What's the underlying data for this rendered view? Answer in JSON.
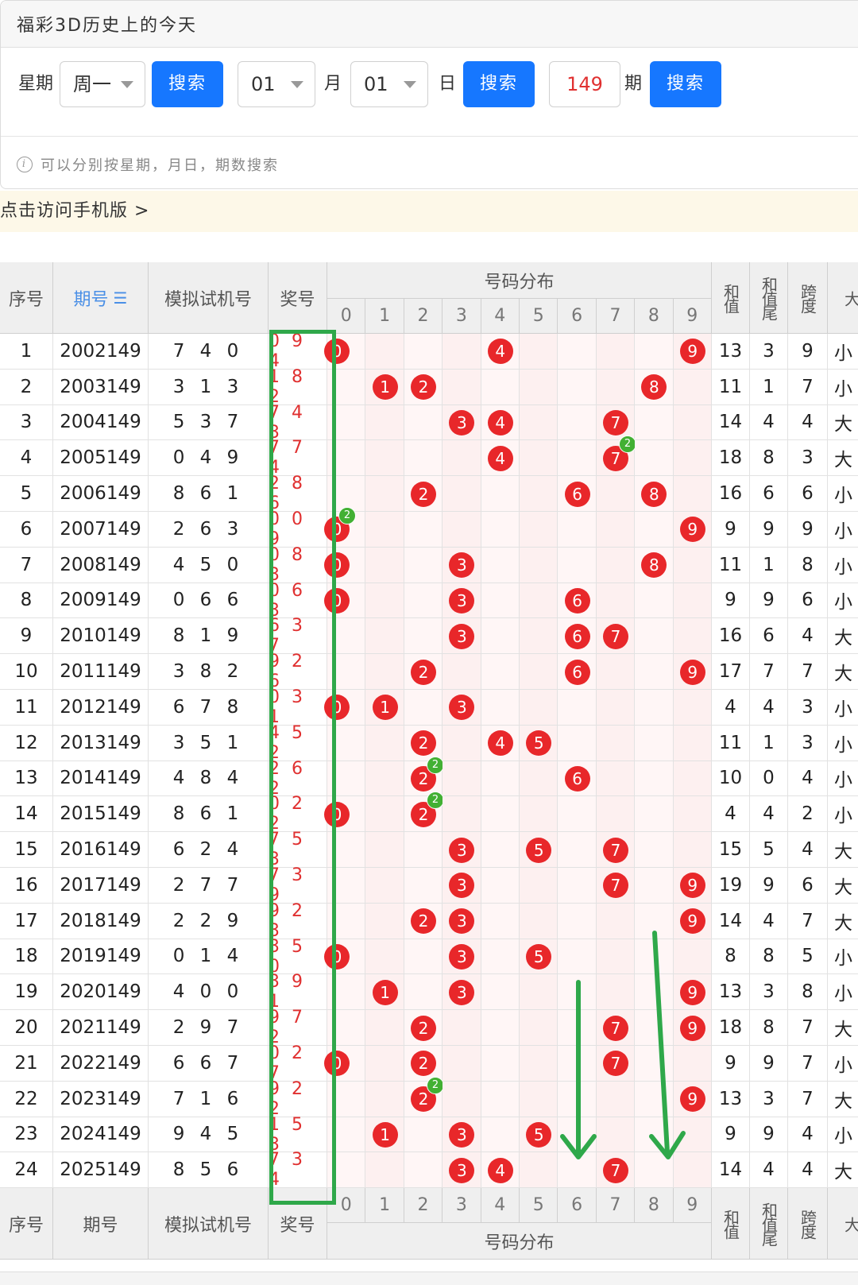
{
  "header": {
    "title": "福彩3D历史上的今天"
  },
  "search": {
    "weekday_label": "星期",
    "weekday_value": "周一",
    "search_btn": "搜索",
    "month_value": "01",
    "month_label": "月",
    "day_value": "01",
    "day_label": "日",
    "issue_value": "149",
    "issue_label": "期"
  },
  "hint": "可以分别按星期，月日，期数搜索",
  "mobile_link": "点击访问手机版 >",
  "table": {
    "headers": {
      "seq": "序号",
      "issue": "期号",
      "trial": "模拟试机号",
      "award": "奖号",
      "dist": "号码分布",
      "sum": "和值",
      "sum_tail": "和值尾",
      "span": "跨度",
      "big": "大"
    },
    "digits": [
      "0",
      "1",
      "2",
      "3",
      "4",
      "5",
      "6",
      "7",
      "8",
      "9"
    ],
    "rows": [
      {
        "seq": "1",
        "issue": "2002149",
        "trial": "7 4 0",
        "award": "0 9 4",
        "balls": [
          0,
          4,
          9
        ],
        "rep": [],
        "sum": "13",
        "tail": "3",
        "span": "9",
        "size": "小"
      },
      {
        "seq": "2",
        "issue": "2003149",
        "trial": "3 1 3",
        "award": "1 8 2",
        "balls": [
          1,
          2,
          8
        ],
        "rep": [],
        "sum": "11",
        "tail": "1",
        "span": "7",
        "size": "小"
      },
      {
        "seq": "3",
        "issue": "2004149",
        "trial": "5 3 7",
        "award": "7 4 3",
        "balls": [
          3,
          4,
          7
        ],
        "rep": [],
        "sum": "14",
        "tail": "4",
        "span": "4",
        "size": "大"
      },
      {
        "seq": "4",
        "issue": "2005149",
        "trial": "0 4 9",
        "award": "7 7 4",
        "balls": [
          4,
          7
        ],
        "rep": [
          7
        ],
        "sum": "18",
        "tail": "8",
        "span": "3",
        "size": "大"
      },
      {
        "seq": "5",
        "issue": "2006149",
        "trial": "8 6 1",
        "award": "2 8 6",
        "balls": [
          2,
          6,
          8
        ],
        "rep": [],
        "sum": "16",
        "tail": "6",
        "span": "6",
        "size": "小"
      },
      {
        "seq": "6",
        "issue": "2007149",
        "trial": "2 6 3",
        "award": "0 0 9",
        "balls": [
          0,
          9
        ],
        "rep": [
          0
        ],
        "sum": "9",
        "tail": "9",
        "span": "9",
        "size": "小"
      },
      {
        "seq": "7",
        "issue": "2008149",
        "trial": "4 5 0",
        "award": "0 8 3",
        "balls": [
          0,
          3,
          8
        ],
        "rep": [],
        "sum": "11",
        "tail": "1",
        "span": "8",
        "size": "小"
      },
      {
        "seq": "8",
        "issue": "2009149",
        "trial": "0 6 6",
        "award": "0 6 3",
        "balls": [
          0,
          3,
          6
        ],
        "rep": [],
        "sum": "9",
        "tail": "9",
        "span": "6",
        "size": "小"
      },
      {
        "seq": "9",
        "issue": "2010149",
        "trial": "8 1 9",
        "award": "6 3 7",
        "balls": [
          3,
          6,
          7
        ],
        "rep": [],
        "sum": "16",
        "tail": "6",
        "span": "4",
        "size": "大"
      },
      {
        "seq": "10",
        "issue": "2011149",
        "trial": "3 8 2",
        "award": "9 2 6",
        "balls": [
          2,
          6,
          9
        ],
        "rep": [],
        "sum": "17",
        "tail": "7",
        "span": "7",
        "size": "大"
      },
      {
        "seq": "11",
        "issue": "2012149",
        "trial": "6 7 8",
        "award": "0 3 1",
        "balls": [
          0,
          1,
          3
        ],
        "rep": [],
        "sum": "4",
        "tail": "4",
        "span": "3",
        "size": "小"
      },
      {
        "seq": "12",
        "issue": "2013149",
        "trial": "3 5 1",
        "award": "4 5 2",
        "balls": [
          2,
          4,
          5
        ],
        "rep": [],
        "sum": "11",
        "tail": "1",
        "span": "3",
        "size": "小"
      },
      {
        "seq": "13",
        "issue": "2014149",
        "trial": "4 8 4",
        "award": "2 6 2",
        "balls": [
          2,
          6
        ],
        "rep": [
          2
        ],
        "sum": "10",
        "tail": "0",
        "span": "4",
        "size": "小"
      },
      {
        "seq": "14",
        "issue": "2015149",
        "trial": "8 6 1",
        "award": "0 2 2",
        "balls": [
          0,
          2
        ],
        "rep": [
          2
        ],
        "sum": "4",
        "tail": "4",
        "span": "2",
        "size": "小"
      },
      {
        "seq": "15",
        "issue": "2016149",
        "trial": "6 2 4",
        "award": "7 5 3",
        "balls": [
          3,
          5,
          7
        ],
        "rep": [],
        "sum": "15",
        "tail": "5",
        "span": "4",
        "size": "大"
      },
      {
        "seq": "16",
        "issue": "2017149",
        "trial": "2 7 7",
        "award": "7 3 9",
        "balls": [
          3,
          7,
          9
        ],
        "rep": [],
        "sum": "19",
        "tail": "9",
        "span": "6",
        "size": "大"
      },
      {
        "seq": "17",
        "issue": "2018149",
        "trial": "2 2 9",
        "award": "9 2 3",
        "balls": [
          2,
          3,
          9
        ],
        "rep": [],
        "sum": "14",
        "tail": "4",
        "span": "7",
        "size": "大"
      },
      {
        "seq": "18",
        "issue": "2019149",
        "trial": "0 1 4",
        "award": "3 5 0",
        "balls": [
          0,
          3,
          5
        ],
        "rep": [],
        "sum": "8",
        "tail": "8",
        "span": "5",
        "size": "小"
      },
      {
        "seq": "19",
        "issue": "2020149",
        "trial": "4 0 0",
        "award": "3 9 1",
        "balls": [
          1,
          3,
          9
        ],
        "rep": [],
        "sum": "13",
        "tail": "3",
        "span": "8",
        "size": "小"
      },
      {
        "seq": "20",
        "issue": "2021149",
        "trial": "2 9 7",
        "award": "9 7 2",
        "balls": [
          2,
          7,
          9
        ],
        "rep": [],
        "sum": "18",
        "tail": "8",
        "span": "7",
        "size": "大"
      },
      {
        "seq": "21",
        "issue": "2022149",
        "trial": "6 6 7",
        "award": "0 2 7",
        "balls": [
          0,
          2,
          7
        ],
        "rep": [],
        "sum": "9",
        "tail": "9",
        "span": "7",
        "size": "小"
      },
      {
        "seq": "22",
        "issue": "2023149",
        "trial": "7 1 6",
        "award": "9 2 2",
        "balls": [
          2,
          9
        ],
        "rep": [
          2
        ],
        "sum": "13",
        "tail": "3",
        "span": "7",
        "size": "大"
      },
      {
        "seq": "23",
        "issue": "2024149",
        "trial": "9 4 5",
        "award": "1 5 3",
        "balls": [
          1,
          3,
          5
        ],
        "rep": [],
        "sum": "9",
        "tail": "9",
        "span": "4",
        "size": "小"
      },
      {
        "seq": "24",
        "issue": "2025149",
        "trial": "8 5 6",
        "award": "7 3 4",
        "balls": [
          3,
          4,
          7
        ],
        "rep": [],
        "sum": "14",
        "tail": "4",
        "span": "4",
        "size": "大"
      }
    ]
  },
  "colors": {
    "ball": "#e8272a",
    "repeat_badge": "#42b033",
    "button": "#1677ff",
    "annotation": "#2fa84a"
  }
}
